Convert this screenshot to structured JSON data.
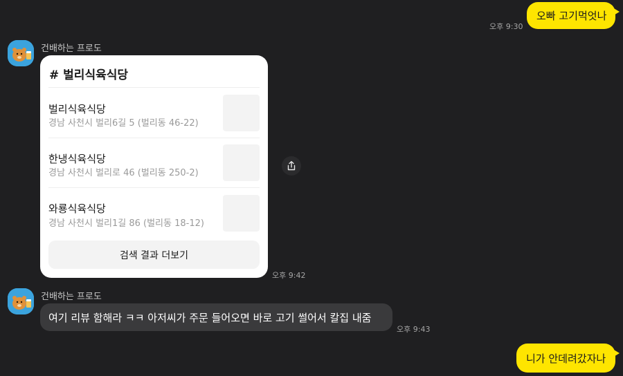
{
  "messages": {
    "m1": {
      "text": "오빠 고기먹엇나",
      "time": "오후 9:30"
    },
    "m2": {
      "sender": "건배하는 프로도",
      "time": "오후 9:42",
      "card": {
        "title": "# 벌리식육식당",
        "results": [
          {
            "name": "벌리식육식당",
            "address": "경남 사천시 벌리6길 5 (벌리동 46-22)"
          },
          {
            "name": "한냉식육식당",
            "address": "경남 사천시 벌리로 46 (벌리동 250-2)"
          },
          {
            "name": "와룡식육식당",
            "address": "경남 사천시 벌리1길 86 (벌리동 18-12)"
          }
        ],
        "more_label": "검색 결과 더보기"
      }
    },
    "m3": {
      "sender": "건배하는 프로도",
      "text": "여기 리뷰 함해라 ㅋㅋ 아저씨가 주문 들어오면 바로 고기 썰어서 칼집 내줌",
      "time": "오후 9:43"
    },
    "m4": {
      "text": "니가 안데려갔자나"
    }
  },
  "icons": {
    "avatar": "ryan-beer-avatar-icon",
    "share": "share-icon"
  },
  "colors": {
    "background": "#1f1f21",
    "my_bubble": "#fee500",
    "other_bubble": "#3a3a3c"
  }
}
